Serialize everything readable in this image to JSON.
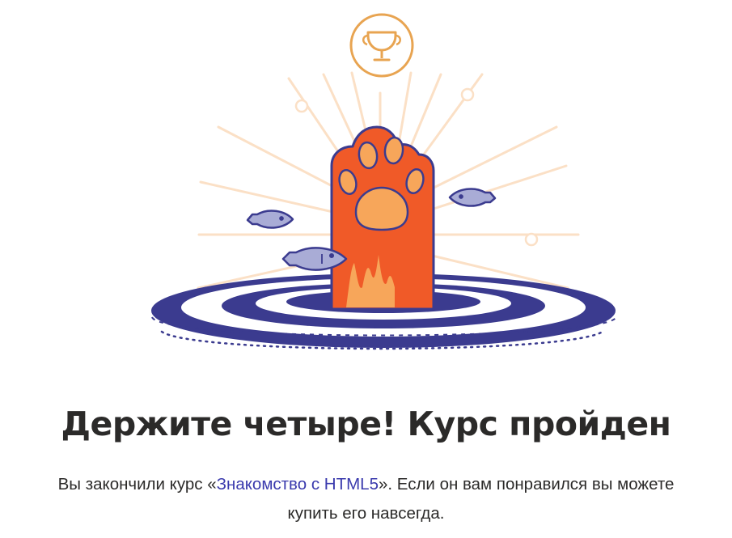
{
  "illustration": {
    "icons": {
      "trophy": "trophy-icon",
      "paw": "cat-paw-icon",
      "fish": "fish-icon"
    },
    "colors": {
      "paw_orange": "#f05a28",
      "pad_peach": "#f7a65a",
      "ring_blue": "#3b3b8f",
      "fish_lavender": "#a9acd6",
      "ray_peach": "#fbe0c6",
      "trophy_gold": "#e8a451"
    }
  },
  "headline": "Держите четыре! Курс пройден",
  "message": {
    "before_link": "Вы закончили курс «",
    "course_name": "Знакомство с HTML5",
    "after_link": "». Если он вам понравился вы можете купить его навсегда."
  },
  "colors": {
    "text": "#2b2a29",
    "link": "#3a3aad"
  }
}
